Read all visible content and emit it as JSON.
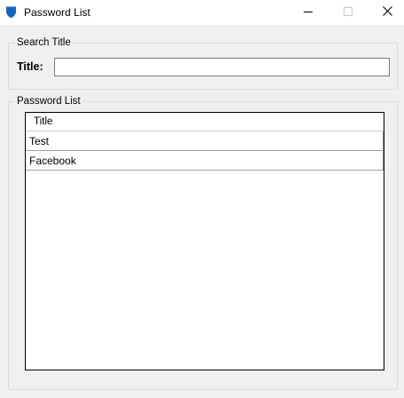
{
  "window": {
    "title": "Password List"
  },
  "search_group": {
    "legend": "Search Title",
    "title_label": "Title:",
    "title_value": ""
  },
  "list_group": {
    "legend": "Password List",
    "column_header": "Title",
    "rows": [
      "Test",
      "Facebook"
    ]
  },
  "icons": {
    "app": "shield-icon",
    "minimize": "minimize-icon",
    "maximize": "maximize-icon",
    "close": "close-icon"
  },
  "colors": {
    "app_icon": "#1565c0",
    "titlebar_bg": "#ffffff",
    "window_bg": "#f0f0f0"
  }
}
